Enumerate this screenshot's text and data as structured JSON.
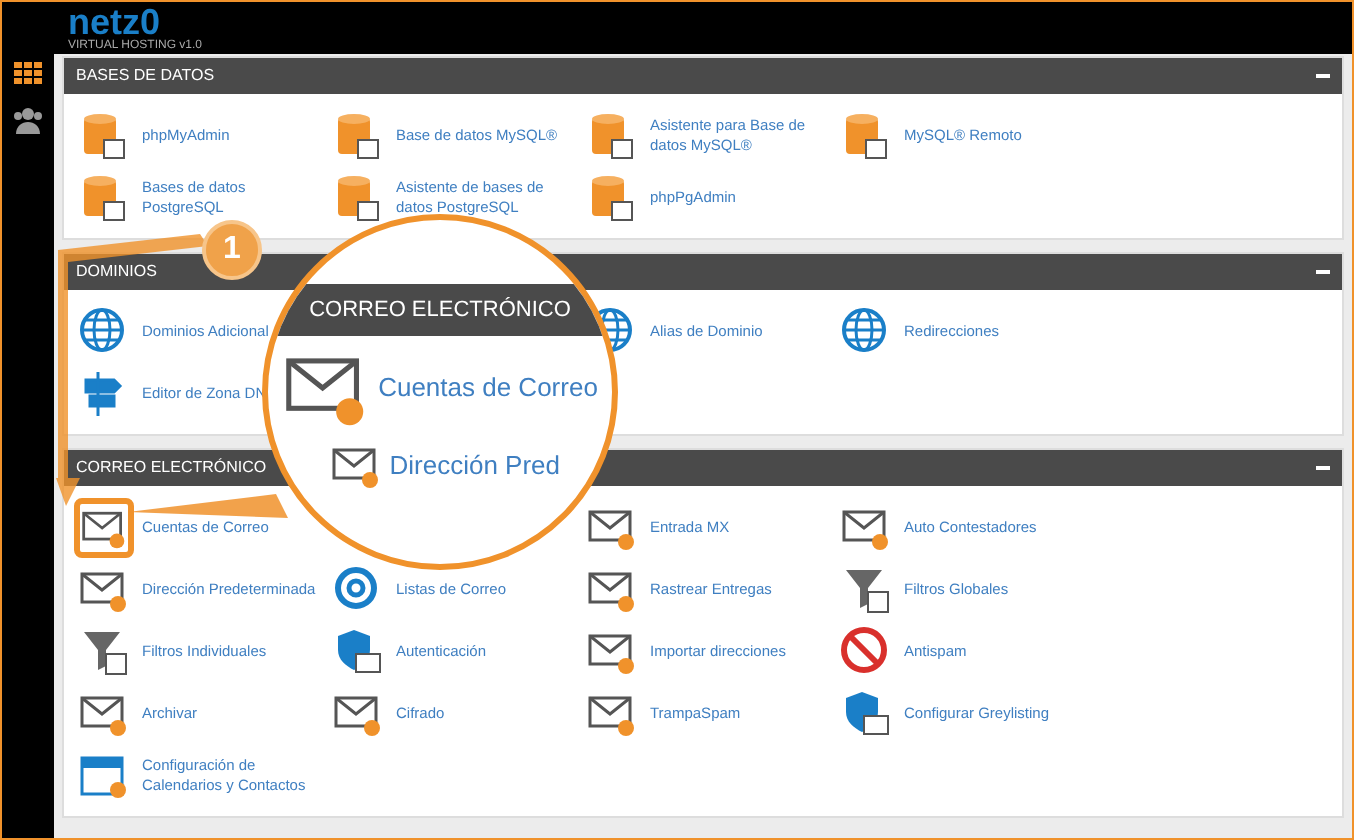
{
  "header": {
    "logo": "netz0",
    "tagline": "VIRTUAL HOSTING v1.0"
  },
  "sidebar": {
    "items": [
      {
        "kind": "grid",
        "selected": true
      },
      {
        "kind": "users",
        "selected": false
      }
    ]
  },
  "sections": [
    {
      "title": "BASES DE DATOS",
      "items": [
        {
          "kind": "database",
          "label": "phpMyAdmin"
        },
        {
          "kind": "database",
          "label": "Base de datos MySQL®"
        },
        {
          "kind": "database",
          "label": "Asistente para Base de datos MySQL®"
        },
        {
          "kind": "database",
          "label": "MySQL® Remoto"
        },
        {
          "kind": "database",
          "label": "Bases de datos PostgreSQL"
        },
        {
          "kind": "database",
          "label": "Asistente de bases de datos PostgreSQL"
        },
        {
          "kind": "database",
          "label": "phpPgAdmin"
        }
      ]
    },
    {
      "title": "DOMINIOS",
      "items": [
        {
          "kind": "globe",
          "label": "Dominios Adicional"
        },
        {
          "kind": "covered"
        },
        {
          "kind": "globe",
          "label": "Alias de Dominio"
        },
        {
          "kind": "globe",
          "label": "Redirecciones"
        },
        {
          "kind": "signpost",
          "label": "Editor de Zona DN"
        }
      ]
    },
    {
      "title": "CORREO ELECTRÓNICO",
      "items": [
        {
          "kind": "mail",
          "label": "Cuentas de Correo",
          "highlighted": true
        },
        {
          "kind": "covered"
        },
        {
          "kind": "mail",
          "label": "Entrada MX"
        },
        {
          "kind": "mail",
          "label": "Auto Contestadores"
        },
        {
          "kind": "mail",
          "label": "Dirección Predeterminada"
        },
        {
          "kind": "at",
          "label": "Listas de Correo"
        },
        {
          "kind": "mail",
          "label": "Rastrear Entregas"
        },
        {
          "kind": "funnel",
          "label": "Filtros Globales"
        },
        {
          "kind": "funnel",
          "label": "Filtros Individuales"
        },
        {
          "kind": "shield",
          "label": "Autenticación"
        },
        {
          "kind": "mail",
          "label": "Importar direcciones"
        },
        {
          "kind": "spam",
          "label": "Antispam"
        },
        {
          "kind": "mail",
          "label": "Archivar"
        },
        {
          "kind": "mail",
          "label": "Cifrado"
        },
        {
          "kind": "mail",
          "label": "TrampaSpam"
        },
        {
          "kind": "shield",
          "label": "Configurar Greylisting"
        },
        {
          "kind": "calendar",
          "label": "Configuración de Calendarios y Contactos"
        }
      ]
    }
  ],
  "callout": {
    "badge": "1",
    "magnifier": {
      "title": "CORREO ELECTRÓNICO",
      "items": [
        "Cuentas de Correo",
        "Dirección Pred"
      ]
    }
  }
}
